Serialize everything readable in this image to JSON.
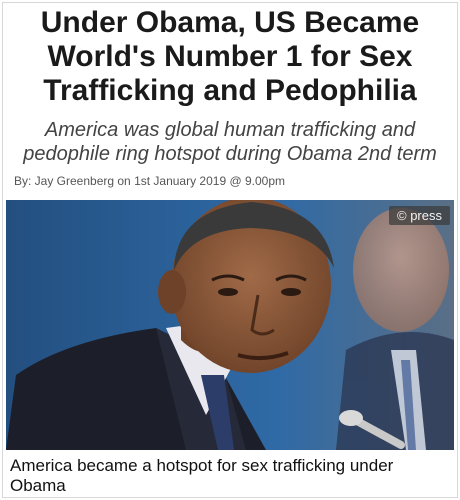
{
  "article": {
    "headline": "Under Obama, US Became World's Number 1 for Sex Trafficking and Pedophilia",
    "subheadline": "America was global human trafficking and pedophile ring hotspot during Obama 2nd term",
    "byline": "By: Jay Greenberg on 1st January 2019 @ 9.00pm",
    "photo_credit": "© press",
    "caption": "America became a hotspot for sex trafficking under Obama"
  },
  "colors": {
    "photo_background": "#2a5a8c",
    "suit": "#1c1f2a",
    "skin": "#8a5a3c"
  },
  "icons": {
    "photo_subject": "man-in-suit-portrait"
  }
}
